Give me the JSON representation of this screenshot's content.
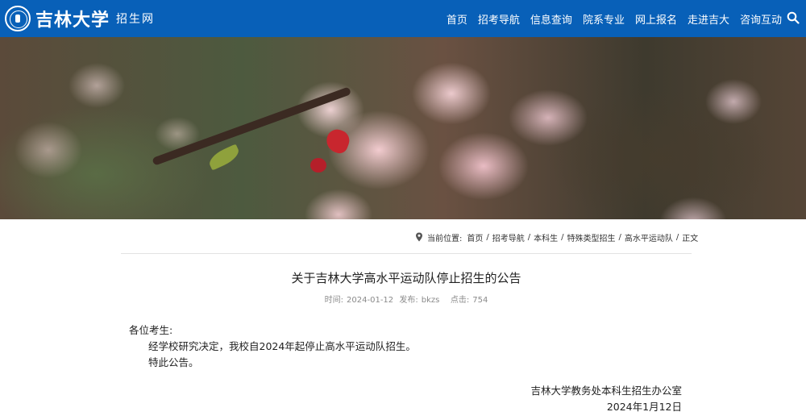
{
  "header": {
    "logo_name": "吉林大学",
    "logo_sub": "招生网",
    "nav": [
      "首页",
      "招考导航",
      "信息查询",
      "院系专业",
      "网上报名",
      "走进吉大",
      "咨询互动"
    ],
    "search_icon": "search-icon",
    "background_color": "#0860b8"
  },
  "breadcrumb": {
    "prefix": "当前位置:",
    "items": [
      "首页",
      "招考导航",
      "本科生",
      "特殊类型招生",
      "高水平运动队",
      "正文"
    ],
    "separator": "/"
  },
  "article": {
    "title": "关于吉林大学高水平运动队停止招生的公告",
    "meta": {
      "time_label": "时间:",
      "time": "2024-01-12",
      "publisher_label": "发布:",
      "publisher": "bkzs",
      "clicks_label": "点击:",
      "clicks": "754"
    },
    "greeting": "各位考生:",
    "paragraphs": [
      "经学校研究决定，我校自2024年起停止高水平运动队招生。",
      "特此公告。"
    ],
    "signature_org": "吉林大学教务处本科生招生办公室",
    "signature_date": "2024年1月12日"
  }
}
